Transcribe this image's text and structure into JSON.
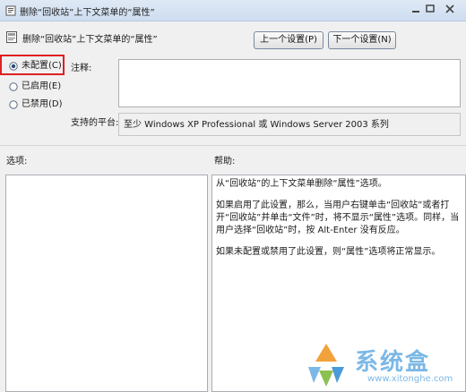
{
  "window": {
    "title": "删除“回收站”上下文菜单的“属性”"
  },
  "header": {
    "setting_name": "删除“回收站”上下文菜单的“属性”",
    "prev_button": "上一个设置(P)",
    "next_button": "下一个设置(N)"
  },
  "state": {
    "options": [
      {
        "label": "未配置(C)",
        "selected": true
      },
      {
        "label": "已启用(E)",
        "selected": false
      },
      {
        "label": "已禁用(D)",
        "selected": false
      }
    ]
  },
  "comment": {
    "label": "注释:",
    "value": ""
  },
  "platform": {
    "label": "支持的平台:",
    "value": "至少 Windows XP Professional 或 Windows Server 2003 系列"
  },
  "panes": {
    "options_label": "选项:",
    "help_label": "帮助:"
  },
  "help": {
    "paragraphs": [
      "从“回收站”的上下文菜单删除“属性”选项。",
      "如果启用了此设置，那么，当用户右键单击“回收站”或者打开“回收站”并单击“文件”时，将不显示“属性”选项。同样，当用户选择“回收站”时，按 Alt-Enter 没有反应。",
      "如果未配置或禁用了此设置，则“属性”选项将正常显示。"
    ]
  },
  "watermark": {
    "brand": "系统盒",
    "url": "www.xitonghe.com"
  },
  "colors": {
    "highlight": "#e02020",
    "watermark": "#7cb8e6"
  }
}
